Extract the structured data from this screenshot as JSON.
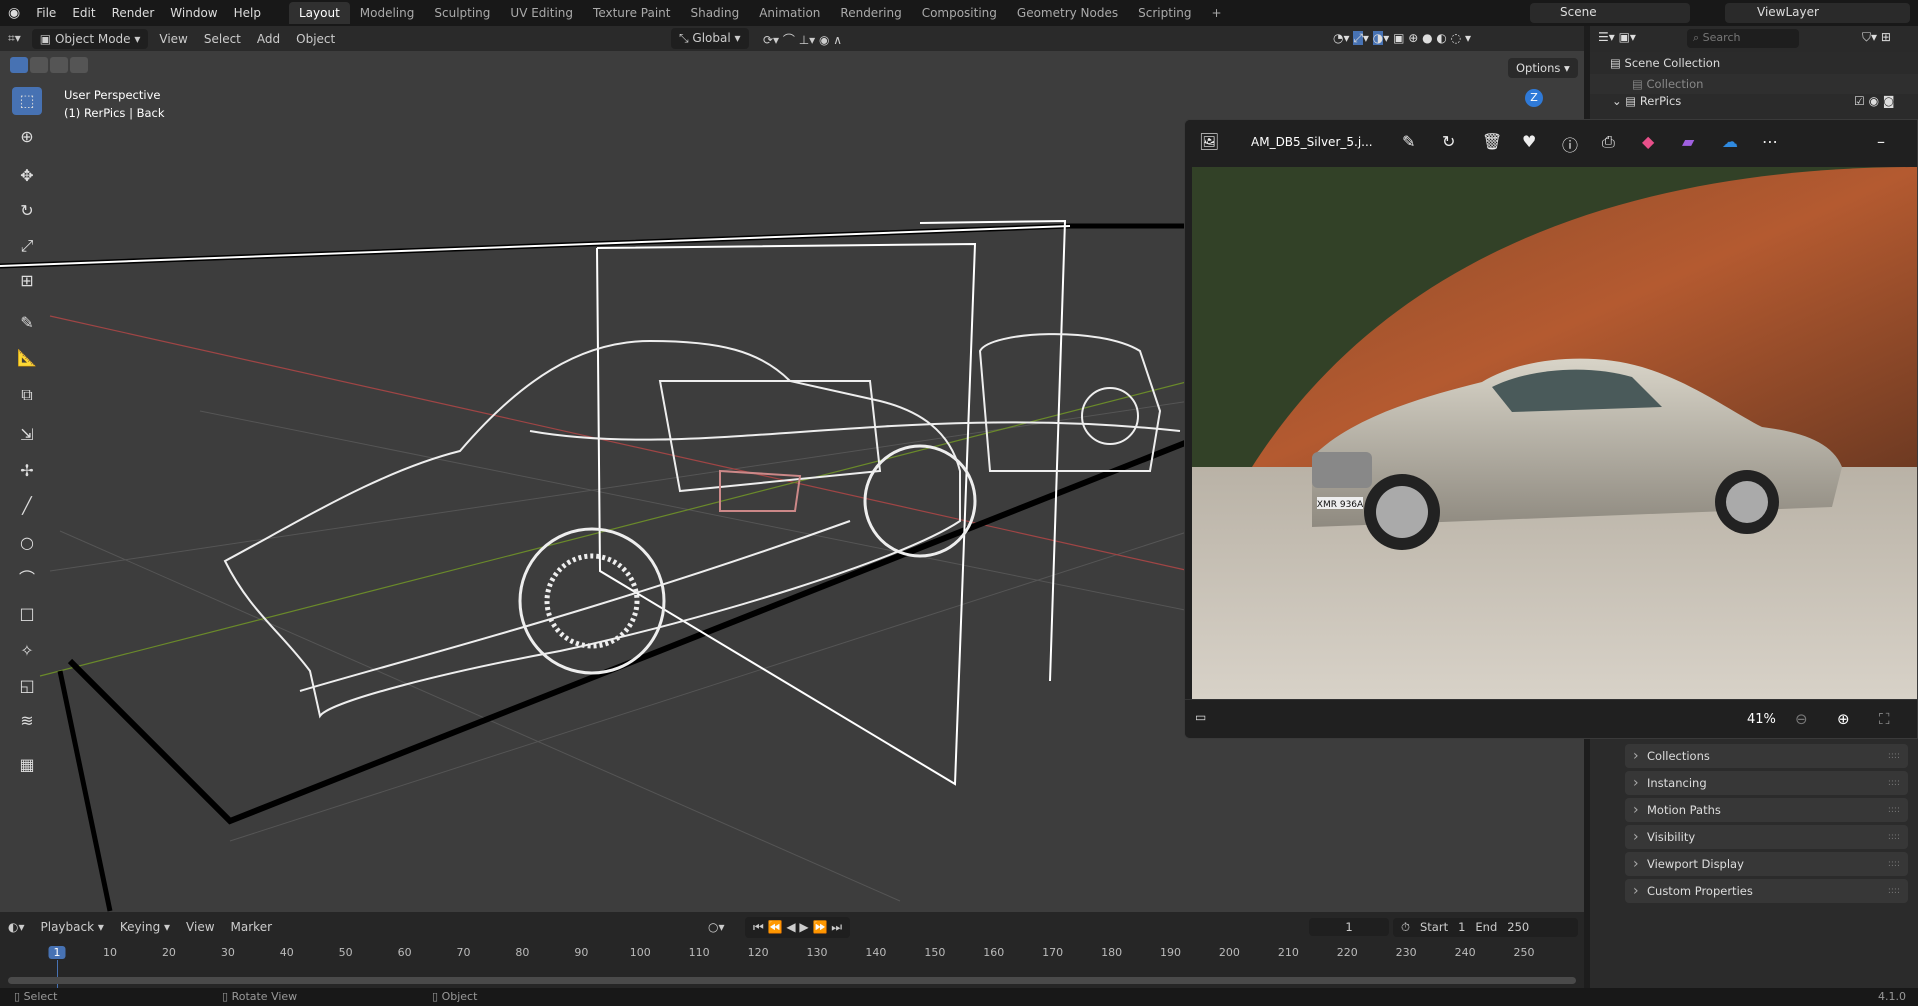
{
  "menubar": {
    "items": [
      "File",
      "Edit",
      "Render",
      "Window",
      "Help"
    ],
    "workspaces": [
      "Layout",
      "Modeling",
      "Sculpting",
      "UV Editing",
      "Texture Paint",
      "Shading",
      "Animation",
      "Rendering",
      "Compositing",
      "Geometry Nodes",
      "Scripting"
    ],
    "active_workspace": "Layout",
    "scene": "Scene",
    "view_layer": "ViewLayer"
  },
  "viewport_header": {
    "mode": "Object Mode",
    "menus": [
      "View",
      "Select",
      "Add",
      "Object"
    ],
    "transform": "Global",
    "options": "Options"
  },
  "viewport": {
    "overlay_line1": "User Perspective",
    "overlay_line2": "(1) RerPics | Back",
    "axis_z": "Z"
  },
  "outliner": {
    "search_placeholder": "Search",
    "scene_collection": "Scene Collection",
    "items": [
      "Collection",
      "RerPics"
    ]
  },
  "viewer": {
    "filename": "AM_DB5_Silver_5.j...",
    "zoom": "41%",
    "plate": "XMR 936A"
  },
  "properties": {
    "panels": [
      "Collections",
      "Instancing",
      "Motion Paths",
      "Visibility",
      "Viewport Display",
      "Custom Properties"
    ]
  },
  "timeline": {
    "menus": [
      "Playback",
      "Keying",
      "View",
      "Marker"
    ],
    "current_frame": "1",
    "start_label": "Start",
    "start": "1",
    "end_label": "End",
    "end": "250",
    "ticks": [
      "1",
      "10",
      "20",
      "30",
      "40",
      "50",
      "60",
      "70",
      "80",
      "90",
      "100",
      "110",
      "120",
      "130",
      "140",
      "150",
      "160",
      "170",
      "180",
      "190",
      "200",
      "210",
      "220",
      "230",
      "240",
      "250"
    ]
  },
  "statusbar": {
    "hints": [
      "Select",
      "Rotate View",
      "Object"
    ],
    "version": "4.1.0"
  },
  "colors": {
    "accent": "#4772b3",
    "viewport_bg": "#3d3d3d"
  }
}
